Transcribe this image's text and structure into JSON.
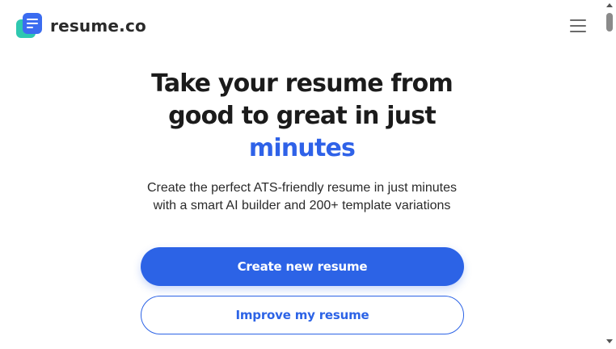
{
  "header": {
    "brand": "resume.co",
    "logo_icon": "document-stack-icon",
    "menu_icon": "hamburger-menu-icon"
  },
  "hero": {
    "headline_line1": "Take your resume from",
    "headline_line2": "good to great in just",
    "headline_accent": "minutes",
    "subtitle": "Create the perfect ATS-friendly resume in just minutes with a smart AI builder and 200+ template variations"
  },
  "actions": {
    "primary_label": "Create new resume",
    "secondary_label": "Improve my resume"
  },
  "colors": {
    "accent": "#2c63e6",
    "logo_teal": "#2ec8b0",
    "logo_blue": "#3b6cf0",
    "text": "#1b1b1b"
  }
}
